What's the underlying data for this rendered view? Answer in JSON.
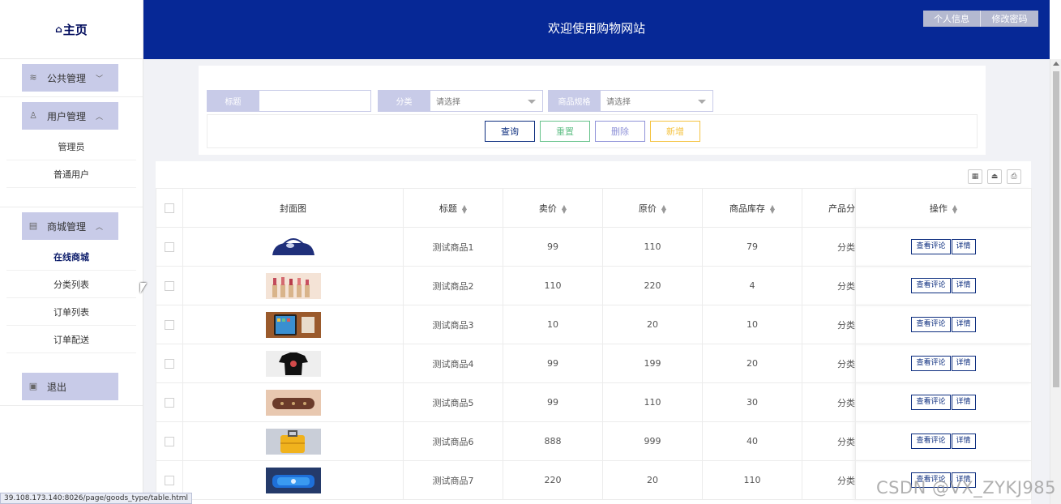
{
  "sidebar": {
    "logo": "主页",
    "groups": [
      {
        "label": "公共管理",
        "icon": "layers-icon",
        "chevron": "﹀",
        "items": []
      },
      {
        "label": "用户管理",
        "icon": "user-icon",
        "chevron": "︿",
        "items": [
          "管理员",
          "普通用户"
        ]
      },
      {
        "label": "商城管理",
        "icon": "grid-icon",
        "chevron": "︿",
        "items": [
          "在线商城",
          "分类列表",
          "订单列表",
          "订单配送"
        ],
        "active": "在线商城"
      },
      {
        "label": "退出",
        "icon": "logout-icon",
        "items": []
      }
    ]
  },
  "header": {
    "title": "欢迎使用购物网站",
    "buttons": [
      "个人信息",
      "修改密码"
    ]
  },
  "search": {
    "title_label": "标题",
    "title_value": "",
    "category_label": "分类",
    "category_placeholder": "请选择",
    "spec_label": "商品规格",
    "spec_placeholder": "请选择",
    "buttons": [
      {
        "label": "查询",
        "color": "#0d2e7f"
      },
      {
        "label": "重置",
        "color": "#67c28b"
      },
      {
        "label": "删除",
        "color": "#8f92d8"
      },
      {
        "label": "新增",
        "color": "#f5c341"
      }
    ]
  },
  "table": {
    "tool_icons": [
      "columns-icon",
      "export-icon",
      "print-icon"
    ],
    "headers": [
      "封面图",
      "标题",
      "卖价",
      "原价",
      "商品库存",
      "产品分",
      "操作"
    ],
    "rows": [
      {
        "title": "测试商品1",
        "price": "99",
        "original": "110",
        "stock": "79",
        "category": "分类",
        "image": "handbag"
      },
      {
        "title": "测试商品2",
        "price": "110",
        "original": "220",
        "stock": "4",
        "category": "分类",
        "image": "lipsticks"
      },
      {
        "title": "测试商品3",
        "price": "10",
        "original": "20",
        "stock": "10",
        "category": "分类",
        "image": "tablet"
      },
      {
        "title": "测试商品4",
        "price": "99",
        "original": "199",
        "stock": "20",
        "category": "分类",
        "image": "tshirt"
      },
      {
        "title": "测试商品5",
        "price": "99",
        "original": "110",
        "stock": "30",
        "category": "分类",
        "image": "pouch"
      },
      {
        "title": "测试商品6",
        "price": "888",
        "original": "999",
        "stock": "40",
        "category": "分类",
        "image": "suitcase"
      },
      {
        "title": "测试商品7",
        "price": "220",
        "original": "20",
        "stock": "110",
        "category": "分类",
        "image": "speaker"
      }
    ],
    "row_actions": [
      "查看评论",
      "详情"
    ]
  },
  "status_url": "39.108.173.140:8026/page/goods_type/table.html",
  "watermark": "CSDN @VX_ZYKJ985"
}
